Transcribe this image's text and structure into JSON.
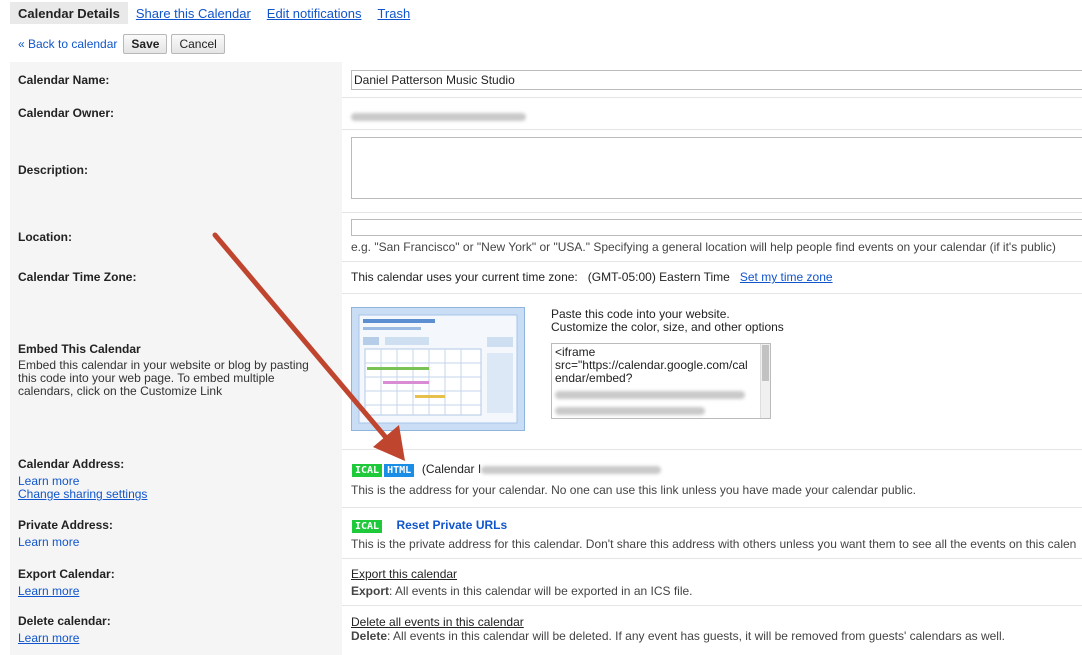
{
  "tabs": [
    "Calendar Details",
    "Share this Calendar",
    "Edit notifications",
    "Trash"
  ],
  "actions": {
    "back": "« Back to calendar",
    "save": "Save",
    "cancel": "Cancel"
  },
  "rows": {
    "name": {
      "label": "Calendar Name:",
      "value": "Daniel Patterson Music Studio"
    },
    "owner": {
      "label": "Calendar Owner:"
    },
    "description": {
      "label": "Description:"
    },
    "location": {
      "label": "Location:",
      "hint": "e.g. \"San Francisco\" or \"New York\" or \"USA.\" Specifying a general location will help people find events on your calendar (if it's public)"
    },
    "timezone": {
      "label": "Calendar Time Zone:",
      "text": "This calendar uses your current time zone:",
      "zone": "(GMT-05:00) Eastern Time",
      "link": "Set my time zone"
    },
    "embed": {
      "label": "Embed This Calendar",
      "desc_lines": [
        "Embed this calendar in your website or blog by pasting",
        "this code into your web page. To embed multiple",
        "calendars, click on the Customize Link"
      ],
      "paste": "Paste this code into your website.",
      "customize": "Customize the color, size, and other options",
      "code_lines": [
        "<iframe",
        "src=\"https://calendar.google.com/cal",
        "endar/embed?"
      ]
    },
    "address": {
      "label": "Calendar Address:",
      "learn": "Learn more",
      "sharing": "Change sharing settings",
      "ical": "ICAL",
      "html": "HTML",
      "id_prefix": "(Calendar I",
      "note": "This is the address for your calendar. No one can use this link unless you have made your calendar public."
    },
    "private": {
      "label": "Private Address:",
      "learn": "Learn more",
      "ical": "ICAL",
      "reset": "Reset Private URLs",
      "note": "This is the private address for this calendar. Don't share this address with others unless you want them to see all the events on this calen"
    },
    "export": {
      "label": "Export Calendar:",
      "learn": "Learn more",
      "link": "Export this calendar",
      "bold": "Export",
      "note": ": All events in this calendar will be exported in an ICS file."
    },
    "delete": {
      "label": "Delete calendar:",
      "learn": "Learn more",
      "link": "Delete all events in this calendar",
      "bold": "Delete",
      "note": ": All events in this calendar will be deleted. If any event has guests, it will be removed from guests' calendars as well."
    }
  },
  "colors": {
    "link": "#1155cc",
    "arrow": "#c0452f",
    "ical": "#1ec93a",
    "html": "#1a8ee6"
  }
}
